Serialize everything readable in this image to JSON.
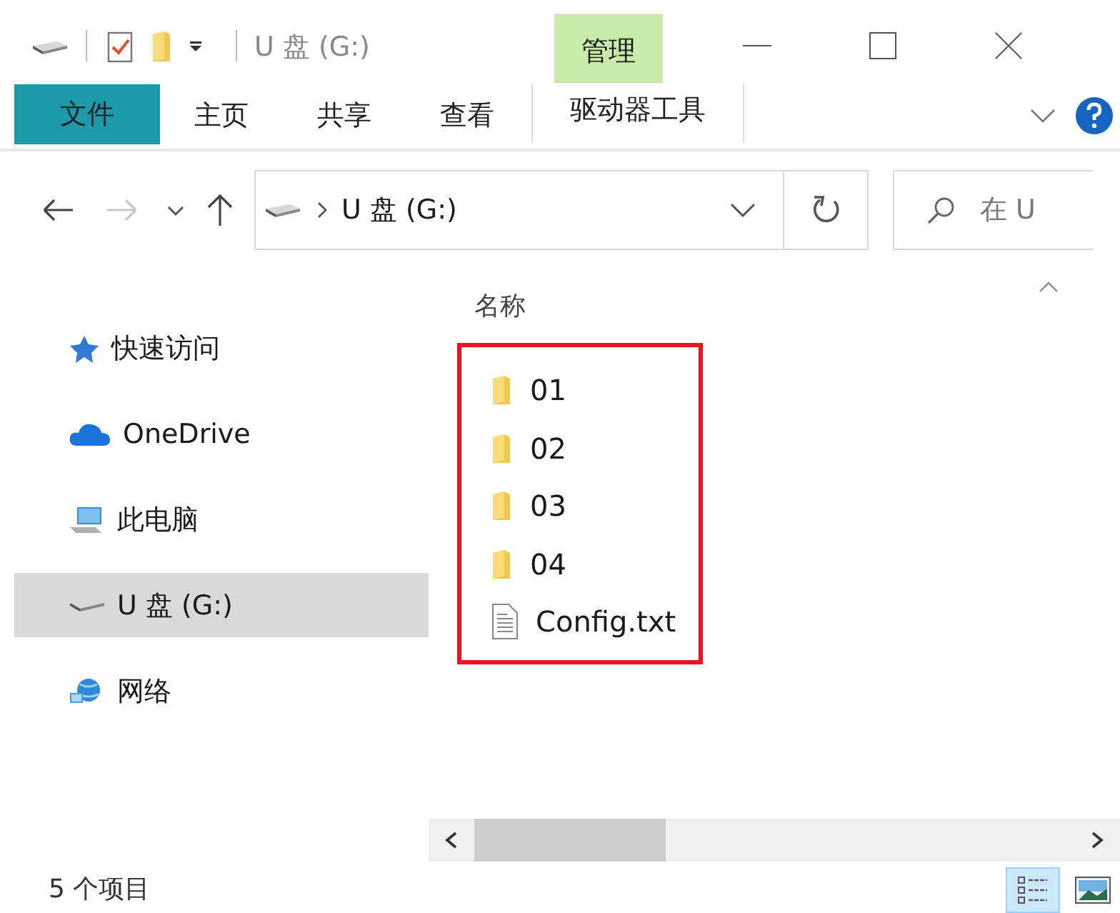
{
  "title_bar": {
    "title": "U 盘 (G:)",
    "contextual_tab": "管理"
  },
  "ribbon": {
    "tabs": [
      {
        "label": "文件",
        "kind": "file"
      },
      {
        "label": "主页",
        "kind": "tab"
      },
      {
        "label": "共享",
        "kind": "tab"
      },
      {
        "label": "查看",
        "kind": "tab"
      },
      {
        "label": "驱动器工具",
        "kind": "contextual"
      }
    ]
  },
  "address_bar": {
    "path": "U 盘 (G:)",
    "search_placeholder": "在 U"
  },
  "navigation": [
    {
      "label": "快速访问",
      "kind": "star",
      "selected": false
    },
    {
      "label": "OneDrive",
      "kind": "cloud",
      "selected": false
    },
    {
      "label": "此电脑",
      "kind": "pc",
      "selected": false
    },
    {
      "label": "U 盘 (G:)",
      "kind": "drive",
      "selected": true
    },
    {
      "label": "网络",
      "kind": "network",
      "selected": false
    }
  ],
  "file_list": {
    "column": "名称",
    "highlighted": true,
    "items": [
      {
        "name": "01",
        "kind": "folder"
      },
      {
        "name": "02",
        "kind": "folder"
      },
      {
        "name": "03",
        "kind": "folder"
      },
      {
        "name": "04",
        "kind": "folder"
      },
      {
        "name": "Config.txt",
        "kind": "text"
      }
    ]
  },
  "status_bar": {
    "count": "5 个项目",
    "views": [
      {
        "kind": "details",
        "selected": true
      },
      {
        "kind": "large",
        "selected": false
      }
    ]
  }
}
